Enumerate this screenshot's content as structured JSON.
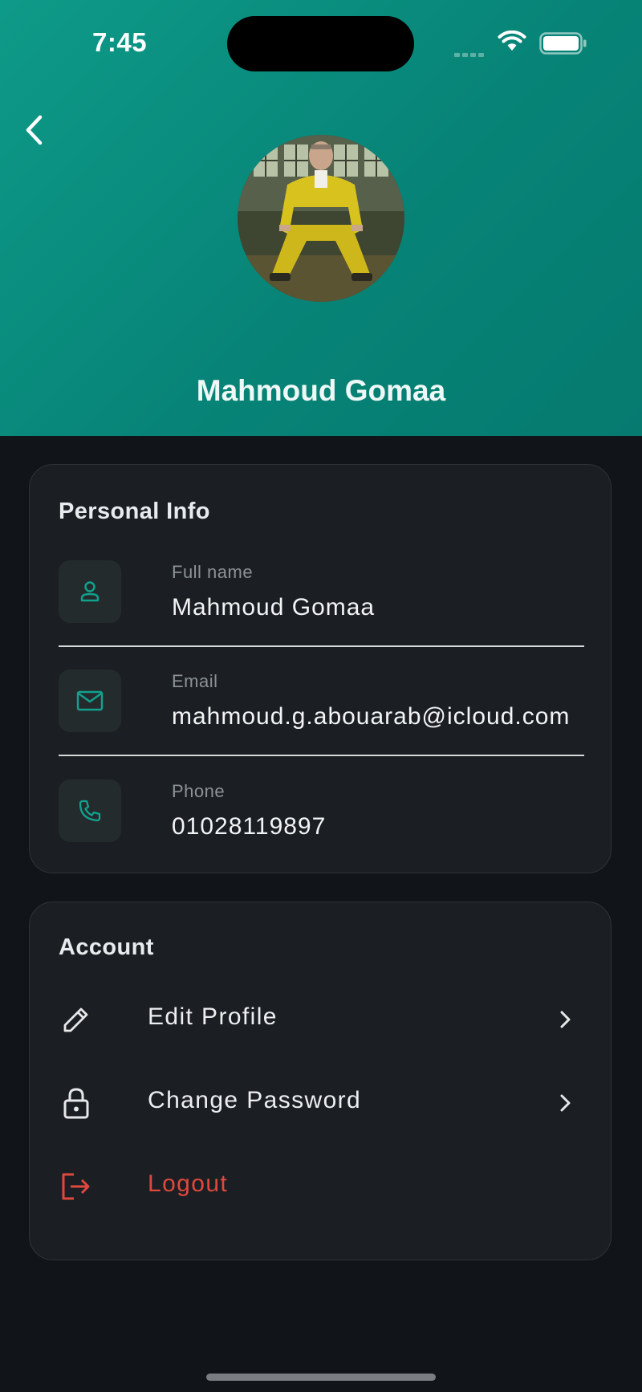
{
  "status_bar": {
    "time": "7:45"
  },
  "profile": {
    "name": "Mahmoud Gomaa"
  },
  "personal_info": {
    "title": "Personal Info",
    "rows": [
      {
        "label": "Full name",
        "value": "Mahmoud Gomaa",
        "icon": "person-icon"
      },
      {
        "label": "Email",
        "value": "mahmoud.g.abouarab@icloud.com",
        "icon": "mail-icon"
      },
      {
        "label": "Phone",
        "value": "01028119897",
        "icon": "phone-icon"
      }
    ]
  },
  "account": {
    "title": "Account",
    "items": [
      {
        "label": "Edit Profile",
        "icon": "pencil-icon"
      },
      {
        "label": "Change Password",
        "icon": "lock-icon"
      },
      {
        "label": "Logout",
        "icon": "logout-icon"
      }
    ]
  },
  "colors": {
    "header_accent": "#078477",
    "icon_accent": "#12a28e",
    "danger": "#e0483d",
    "background": "#111418",
    "card": "#1b1f23"
  }
}
